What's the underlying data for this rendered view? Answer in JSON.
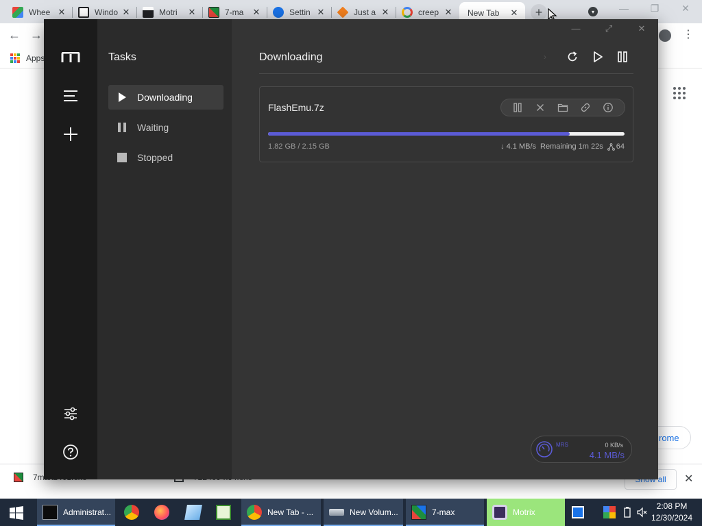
{
  "browser": {
    "tabs": [
      {
        "title": "Whee",
        "color": "#e8453c"
      },
      {
        "title": "Windo",
        "color": "#ffffff"
      },
      {
        "title": "Motri",
        "color": "#ffffff"
      },
      {
        "title": "7-ma",
        "color": "#e8453c"
      },
      {
        "title": "Settin",
        "color": "#1a73e8"
      },
      {
        "title": "Just a",
        "color": "#f4811f"
      },
      {
        "title": "creep",
        "color": "#4285f4"
      },
      {
        "title": "New Tab",
        "color": "#ffffff"
      }
    ],
    "close_glyph": "✕",
    "new_tab_glyph": "+",
    "bookmarks": {
      "apps_label": "Apps"
    },
    "customize_label": "rome",
    "downloads": [
      {
        "name": "7max2401.exe"
      },
      {
        "name": "722409-x64.exe"
      }
    ],
    "show_all_label": "Show all"
  },
  "motrix": {
    "panel_title": "Tasks",
    "nav": [
      {
        "label": "Downloading",
        "icon": "play-icon"
      },
      {
        "label": "Waiting",
        "icon": "pause-icon"
      },
      {
        "label": "Stopped",
        "icon": "stop-icon"
      }
    ],
    "main_title": "Downloading",
    "task": {
      "name": "FlashEmu.7z",
      "progress_percent": 84.7,
      "size_text": "1.82 GB / 2.15 GB",
      "speed_text": "↓ 4.1 MB/s",
      "remaining_text": "Remaining 1m 22s",
      "connections_text": "64"
    },
    "speedometer": {
      "mode": "MRS",
      "upload": "0 KB/s",
      "download": "4.1 MB/s"
    },
    "accent": "#5b5bd6"
  },
  "taskbar": {
    "items": [
      {
        "label": "Administrat...",
        "kind": "open",
        "icon": "cmd-icon"
      },
      {
        "label": "",
        "kind": "pinned",
        "icon": "chrome-icon"
      },
      {
        "label": "",
        "kind": "pinned",
        "icon": "firefox-icon"
      },
      {
        "label": "",
        "kind": "pinned",
        "icon": "notepad-icon"
      },
      {
        "label": "",
        "kind": "pinned",
        "icon": "spreadsheet-icon"
      },
      {
        "label": "New Tab - ...",
        "kind": "open",
        "icon": "chrome-icon"
      },
      {
        "label": "New Volum...",
        "kind": "open",
        "icon": "drive-icon"
      },
      {
        "label": "7-max",
        "kind": "open",
        "icon": "sevenmax-icon"
      },
      {
        "label": "Motrix",
        "kind": "active",
        "icon": "motrix-icon"
      }
    ],
    "time": "2:08 PM",
    "date": "12/30/2024"
  }
}
